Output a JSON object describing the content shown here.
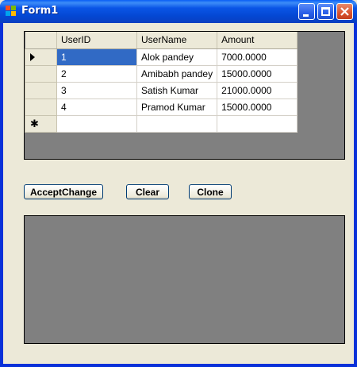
{
  "window": {
    "title": "Form1"
  },
  "grid": {
    "columns": [
      "UserID",
      "UserName",
      "Amount"
    ],
    "rows": [
      {
        "id": "1",
        "name": "Alok pandey",
        "amount": "7000.0000"
      },
      {
        "id": "2",
        "name": "Amibabh pandey",
        "amount": "15000.0000"
      },
      {
        "id": "3",
        "name": "Satish Kumar",
        "amount": "21000.0000"
      },
      {
        "id": "4",
        "name": "Pramod Kumar",
        "amount": "15000.0000"
      }
    ],
    "new_row_marker": "✱"
  },
  "buttons": {
    "accept_change": "AcceptChange",
    "clear": "Clear",
    "clone": "Clone"
  }
}
